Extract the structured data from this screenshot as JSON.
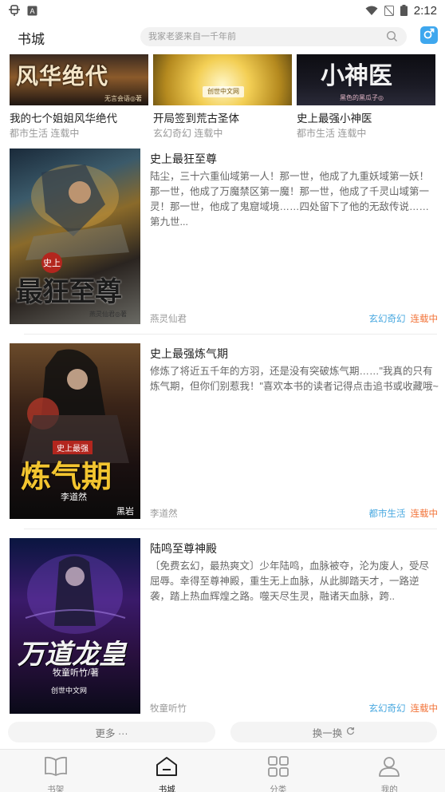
{
  "status_bar": {
    "time": "2:12",
    "left_icons": [
      "bug-notification-icon",
      "a-box-notification-icon"
    ],
    "right_icons": [
      "wifi-icon",
      "no-signal-icon",
      "battery-icon"
    ]
  },
  "header": {
    "title": "书城",
    "search_placeholder": "我家老婆来自一千年前",
    "gender_icon": "male-icon"
  },
  "top_books": [
    {
      "title": "我的七个姐姐风华绝代",
      "genre": "都市生活",
      "status": "连载中",
      "cover_text": "风华绝代",
      "cover_sub": "无言会语◎著"
    },
    {
      "title": "开局签到荒古圣体",
      "genre": "玄幻奇幻",
      "status": "连载中",
      "cover_text": "",
      "cover_sub": "创世中文网"
    },
    {
      "title": "史上最强小神医",
      "genre": "都市生活",
      "status": "连载中",
      "cover_text": "小神医",
      "cover_sub": "黑色的黑瓜子◎"
    }
  ],
  "books": [
    {
      "title": "史上最狂至尊",
      "description": "陆尘，三十六重仙域第一人！那一世，他成了九重妖域第一妖！那一世，他成了万魔禁区第一魔！那一世，他成了千灵山域第一灵！那一世，他成了鬼窟域境……四处留下了他的无敌传说……第九世...",
      "author": "燕灵仙君",
      "genre": "玄幻奇幻",
      "status": "连载中",
      "cover_small": "史上",
      "cover_title": "最狂至尊",
      "cover_author": "燕灵仙君◎著"
    },
    {
      "title": "史上最强炼气期",
      "description": "修炼了将近五千年的方羽，还是没有突破炼气期……\"我真的只有炼气期，但你们别惹我！\"喜欢本书的读者记得点击追书或收藏哦~",
      "author": "李道然",
      "genre": "都市生活",
      "status": "连载中",
      "cover_small": "史上最强",
      "cover_title": "炼气期",
      "cover_author": "李道然",
      "cover_publisher": "黑岩"
    },
    {
      "title": "陆鸣至尊神殿",
      "description": "〔免费玄幻，最热爽文〕少年陆鸣，血脉被夺，沦为废人，受尽屈辱。幸得至尊神殿，重生无上血脉，从此脚踏天才，一路逆袭，踏上热血辉煌之路。噬天尽生灵，融诸天血脉，跨..",
      "author": "牧童听竹",
      "genre": "玄幻奇幻",
      "status": "连载中",
      "cover_title": "万道龙皇",
      "cover_author": "牧童听竹/著",
      "cover_publisher": "创世中文网"
    }
  ],
  "actions": {
    "more": "更多 ···",
    "refresh": "换一换",
    "refresh_icon": "refresh-icon"
  },
  "nav": [
    {
      "label": "书架",
      "icon": "book-icon",
      "active": false
    },
    {
      "label": "书城",
      "icon": "home-icon",
      "active": true
    },
    {
      "label": "分类",
      "icon": "grid-icon",
      "active": false
    },
    {
      "label": "我的",
      "icon": "user-icon",
      "active": false
    }
  ],
  "colors": {
    "genre_tag": "#4aa9e0",
    "status_tag": "#f2743a",
    "gender_button": "#3ea7ee"
  }
}
